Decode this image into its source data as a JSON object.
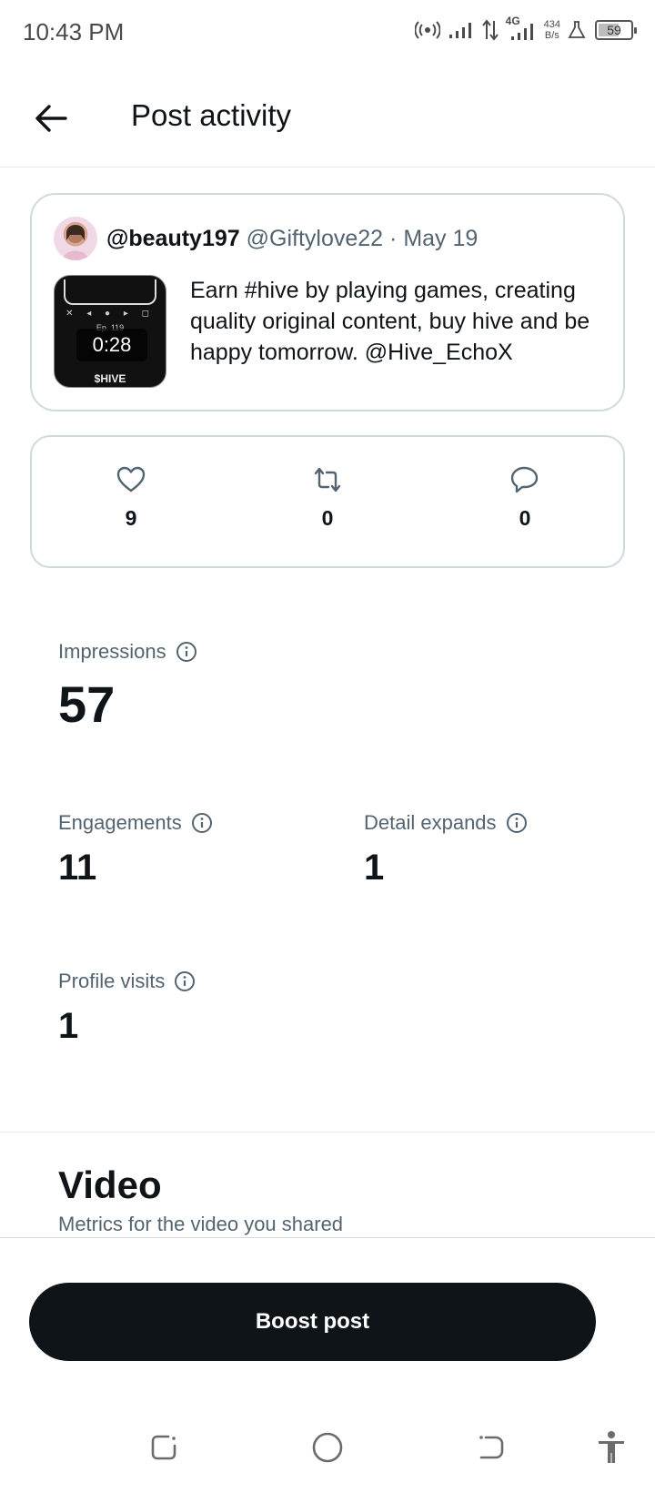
{
  "status_bar": {
    "time": "10:43 PM",
    "network": "4G",
    "speed_value": "434",
    "speed_unit": "B/s",
    "battery": "59"
  },
  "header": {
    "title": "Post activity"
  },
  "post": {
    "author": "@beauty197",
    "handle": "@Giftylove22",
    "separator": "·",
    "date": "May 19",
    "text": "Earn #hive by playing games, creating quality original content, buy hive and be happy tomorrow. @Hive_EchoX",
    "media": {
      "duration": "0:28",
      "episode": "Ep. 119",
      "caption": "$HIVE"
    }
  },
  "engagement": {
    "likes": "9",
    "reposts": "0",
    "replies": "0"
  },
  "metrics": {
    "impressions": {
      "label": "Impressions",
      "value": "57"
    },
    "engagements": {
      "label": "Engagements",
      "value": "11"
    },
    "detail_expands": {
      "label": "Detail expands",
      "value": "1"
    },
    "profile_visits": {
      "label": "Profile visits",
      "value": "1"
    }
  },
  "video": {
    "title": "Video",
    "subtitle": "Metrics for the video you shared"
  },
  "actions": {
    "boost_label": "Boost post"
  },
  "colors": {
    "text_primary": "#0f1419",
    "text_secondary": "#536471",
    "border": "#cfd9de",
    "button_bg": "#0f1419"
  }
}
